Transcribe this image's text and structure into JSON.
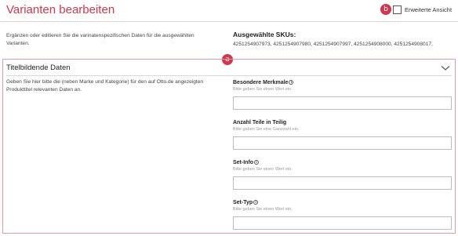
{
  "header": {
    "title": "Varianten bearbeiten"
  },
  "badges": {
    "a": "a",
    "b": "b"
  },
  "extended_view": {
    "label": "Erweiterte Ansicht",
    "checked": false
  },
  "intro": "Ergänzen oder editieren Sie die varinatenspezifischen Daten für die ausgewählten Varianten.",
  "skus": {
    "title": "Ausgewählte SKUs:",
    "list": "4251254907973, 4251254907980, 4251254907997, 4251254908000, 4251254908017,"
  },
  "section": {
    "title": "Titelbildende Daten",
    "description": "Geben Sie hier bitte die (neben Marke und Kategorie) für den auf Otto.de angezeigten Produkttitel relevanten Daten an.",
    "fields": [
      {
        "label": "Besondere Merkmale",
        "hint": "Bitte geben Sie einen Wert ein.",
        "value": ""
      },
      {
        "label": "Anzahl Teile in Teilig",
        "hint": "Bitte geben Sie eine Ganzzahl ein.",
        "value": ""
      },
      {
        "label": "Set-Info",
        "hint": "Bitte geben Sie einen Wert ein.",
        "value": ""
      },
      {
        "label": "Set-Typ",
        "hint": "Bitte geben Sie einen Wert ein.",
        "value": ""
      }
    ]
  },
  "colors": {
    "accent": "#d4364f",
    "section_border": "#e89aa6"
  },
  "icons": {
    "info": "info-icon",
    "chevron": "chevron-down-icon",
    "checkbox": "checkbox-icon"
  }
}
